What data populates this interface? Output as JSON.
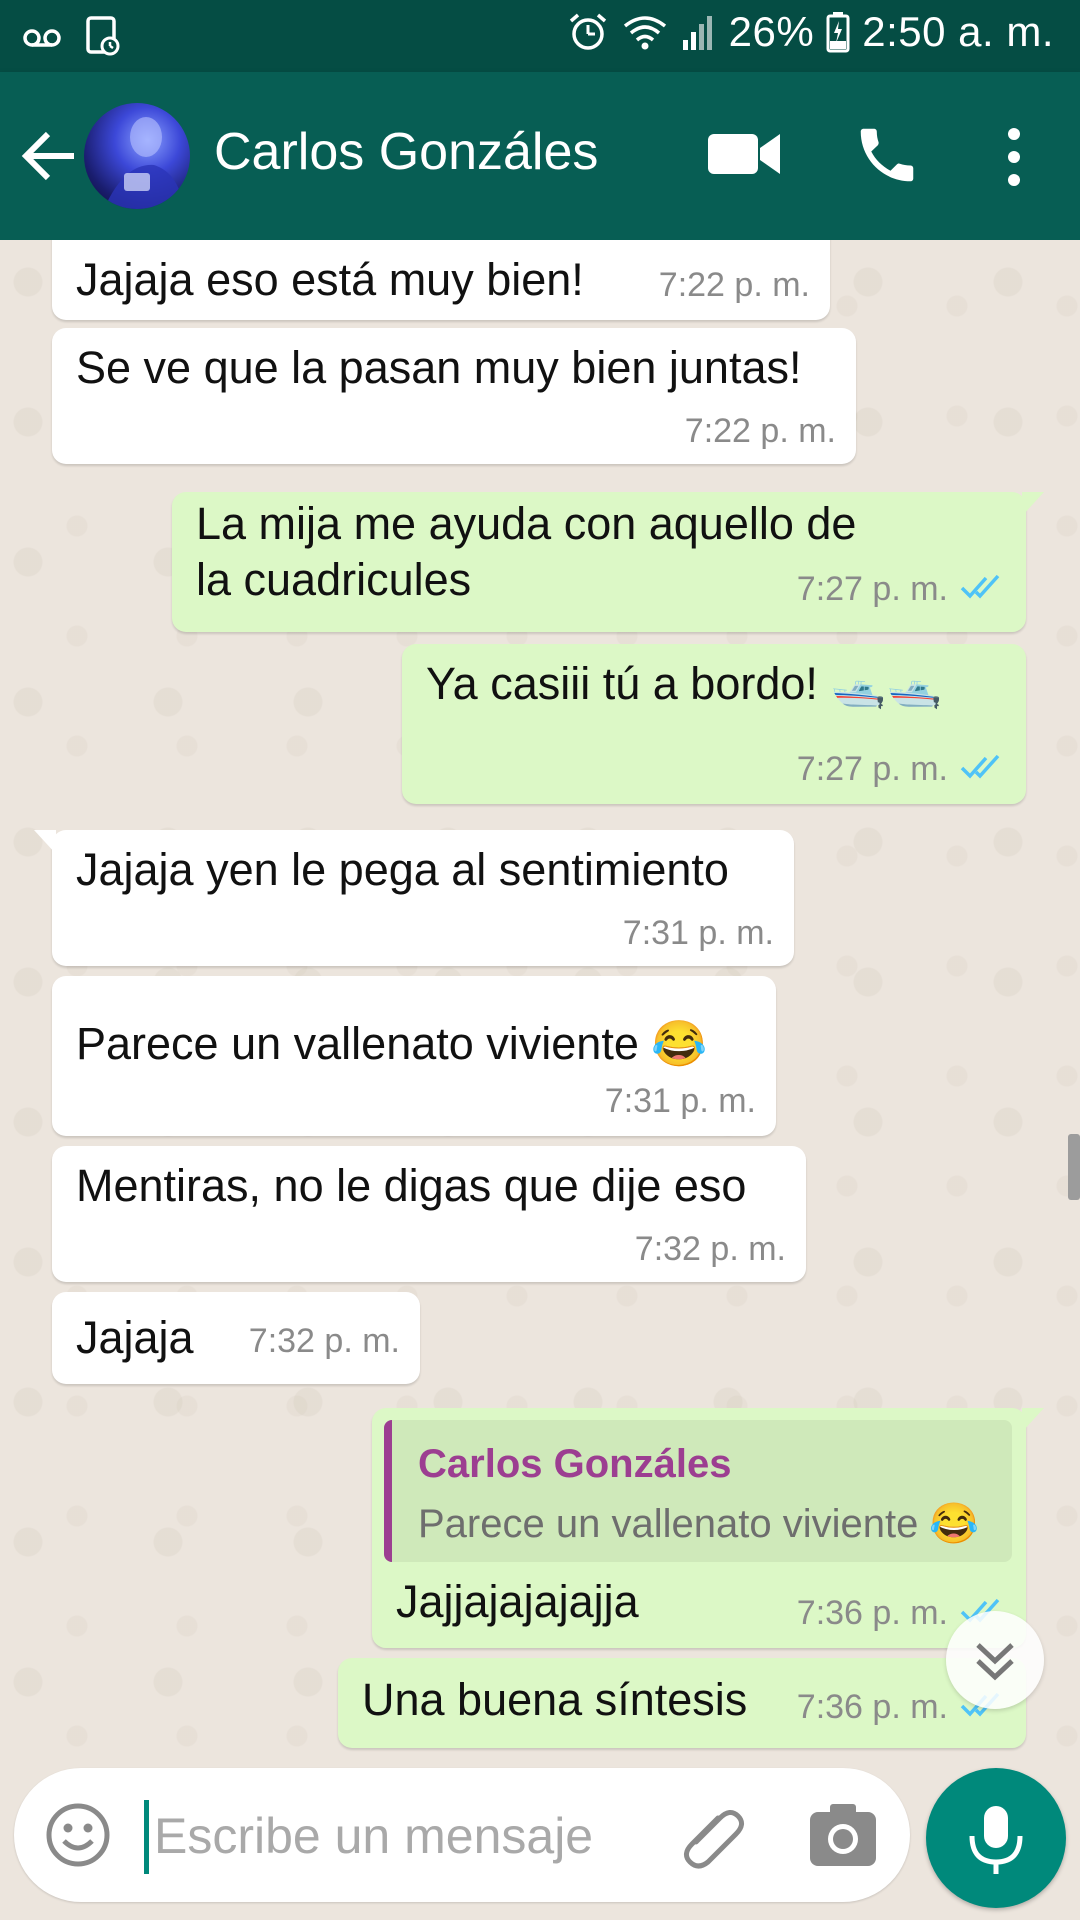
{
  "status_bar": {
    "battery": "26%",
    "time": "2:50 a. m."
  },
  "header": {
    "contact_name": "Carlos Gonzáles"
  },
  "messages": [
    {
      "direction": "in",
      "text": "Jajaja eso está muy bien!",
      "time": "7:22 p. m."
    },
    {
      "direction": "in",
      "text": "Se ve que la pasan muy bien juntas!",
      "time": "7:22 p. m."
    },
    {
      "direction": "out",
      "lines": [
        "La mija me ayuda con aquello de",
        "la cuadricules"
      ],
      "time": "7:27 p. m.",
      "status": "read"
    },
    {
      "direction": "out",
      "text": "Ya casiii tú a bordo! 🛥️🛥️",
      "time": "7:27 p. m.",
      "status": "read"
    },
    {
      "direction": "in",
      "text": "Jajaja yen le pega al sentimiento",
      "time": "7:31 p. m."
    },
    {
      "direction": "in",
      "text": "Parece un vallenato viviente 😂",
      "time": "7:31 p. m."
    },
    {
      "direction": "in",
      "text": "Mentiras, no le digas que dije eso",
      "time": "7:32 p. m."
    },
    {
      "direction": "in",
      "text": "Jajaja",
      "time": "7:32 p. m."
    },
    {
      "direction": "out",
      "quote": {
        "author": "Carlos Gonzáles",
        "text": "Parece un vallenato viviente 😂"
      },
      "text": "Jajjajajajajja",
      "time": "7:36 p. m.",
      "status": "read"
    },
    {
      "direction": "out",
      "text": "Una buena síntesis",
      "time": "7:36 p. m.",
      "status": "read"
    }
  ],
  "composer": {
    "placeholder": "Escribe un mensaje"
  },
  "colors": {
    "header": "#075E54",
    "status_bar": "#054D44",
    "outgoing_bubble": "#DCF8C6",
    "incoming_bubble": "#FFFFFF",
    "read_ticks": "#4FC3F7",
    "accent": "#00897B",
    "quote_author": "#9C3E91"
  },
  "icons": [
    "voicemail-icon",
    "image-icon",
    "alarm-icon",
    "wifi-icon",
    "signal-icon",
    "battery-icon",
    "back-arrow-icon",
    "video-call-icon",
    "phone-icon",
    "more-vert-icon",
    "emoji-icon",
    "paperclip-icon",
    "camera-icon",
    "mic-icon",
    "double-chevron-down-icon",
    "double-check-icon"
  ]
}
